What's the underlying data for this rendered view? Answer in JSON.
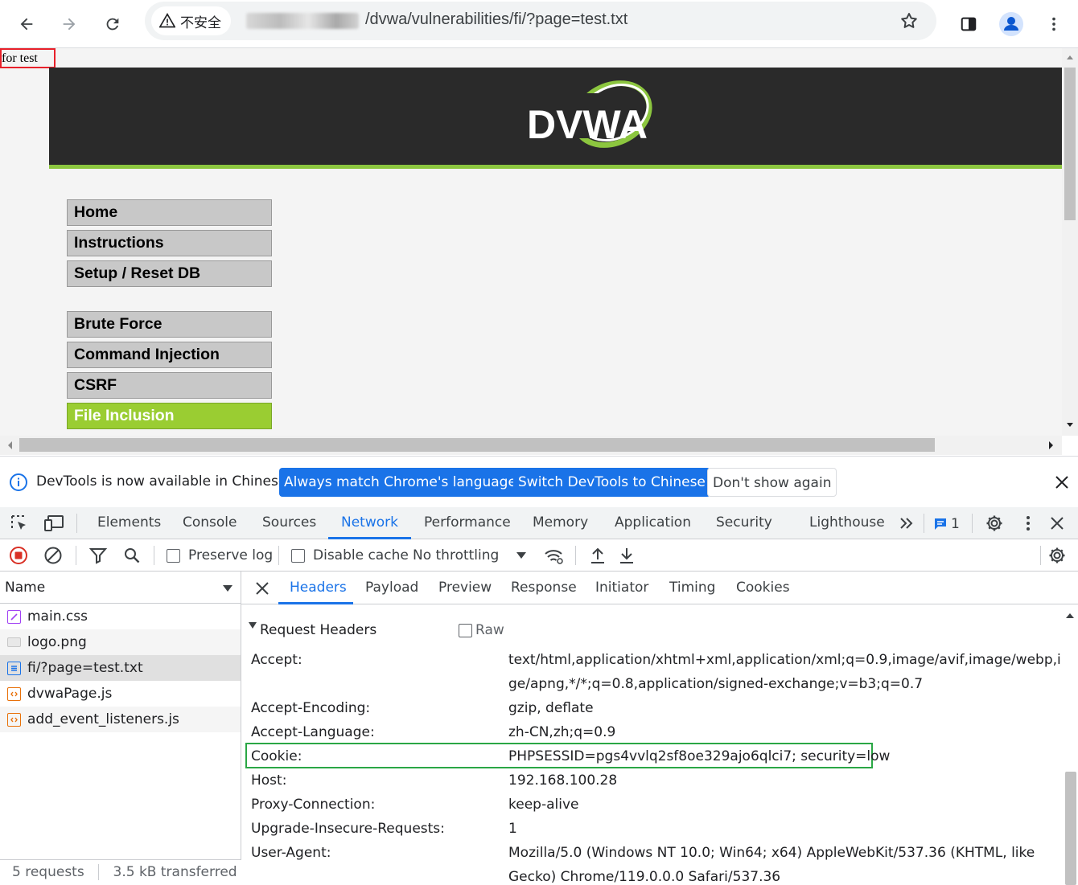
{
  "browser": {
    "security_label": "不安全",
    "url": "/dvwa/vulnerabilities/fi/?page=test.txt"
  },
  "page": {
    "included_text": "for test",
    "logo_text": "DVWA",
    "menu": [
      {
        "label": "Home",
        "active": false
      },
      {
        "label": "Instructions",
        "active": false
      },
      {
        "label": "Setup / Reset DB",
        "active": false
      },
      {
        "label": "Brute Force",
        "active": false
      },
      {
        "label": "Command Injection",
        "active": false
      },
      {
        "label": "CSRF",
        "active": false
      },
      {
        "label": "File Inclusion",
        "active": true
      }
    ]
  },
  "devtools": {
    "infobar": {
      "message": "DevTools is now available in Chinese!",
      "btn_match": "Always match Chrome's language",
      "btn_switch": "Switch DevTools to Chinese",
      "btn_dismiss": "Don't show again"
    },
    "tabs": [
      "Elements",
      "Console",
      "Sources",
      "Network",
      "Performance",
      "Memory",
      "Application",
      "Security",
      "Lighthouse"
    ],
    "selected_tab": "Network",
    "issues_count": "1",
    "network_toolbar": {
      "preserve_log": "Preserve log",
      "disable_cache": "Disable cache",
      "throttling": "No throttling"
    },
    "request_list": {
      "column": "Name",
      "requests": [
        {
          "name": "main.css",
          "type": "css"
        },
        {
          "name": "logo.png",
          "type": "img"
        },
        {
          "name": "fi/?page=test.txt",
          "type": "doc"
        },
        {
          "name": "dvwaPage.js",
          "type": "js"
        },
        {
          "name": "add_event_listeners.js",
          "type": "js"
        }
      ],
      "summary_requests": "5 requests",
      "summary_transferred": "3.5 kB transferred"
    },
    "detail_tabs": [
      "Headers",
      "Payload",
      "Preview",
      "Response",
      "Initiator",
      "Timing",
      "Cookies"
    ],
    "selected_detail_tab": "Headers",
    "request_headers": {
      "section_title": "Request Headers",
      "raw_label": "Raw",
      "rows": [
        {
          "name": "Accept:",
          "value": "text/html,application/xhtml+xml,application/xml;q=0.9,image/avif,image/webp,ima",
          "value2": "ge/apng,*/*;q=0.8,application/signed-exchange;v=b3;q=0.7"
        },
        {
          "name": "Accept-Encoding:",
          "value": "gzip, deflate"
        },
        {
          "name": "Accept-Language:",
          "value": "zh-CN,zh;q=0.9"
        },
        {
          "name": "Cookie:",
          "value": "PHPSESSID=pgs4vvlq2sf8oe329ajo6qlci7; security=low"
        },
        {
          "name": "Host:",
          "value": "192.168.100.28"
        },
        {
          "name": "Proxy-Connection:",
          "value": "keep-alive"
        },
        {
          "name": "Upgrade-Insecure-Requests:",
          "value": "1"
        },
        {
          "name": "User-Agent:",
          "value": "Mozilla/5.0 (Windows NT 10.0; Win64; x64) AppleWebKit/537.36 (KHTML, like",
          "value2": "Gecko) Chrome/119.0.0.0 Safari/537.36"
        }
      ]
    }
  }
}
